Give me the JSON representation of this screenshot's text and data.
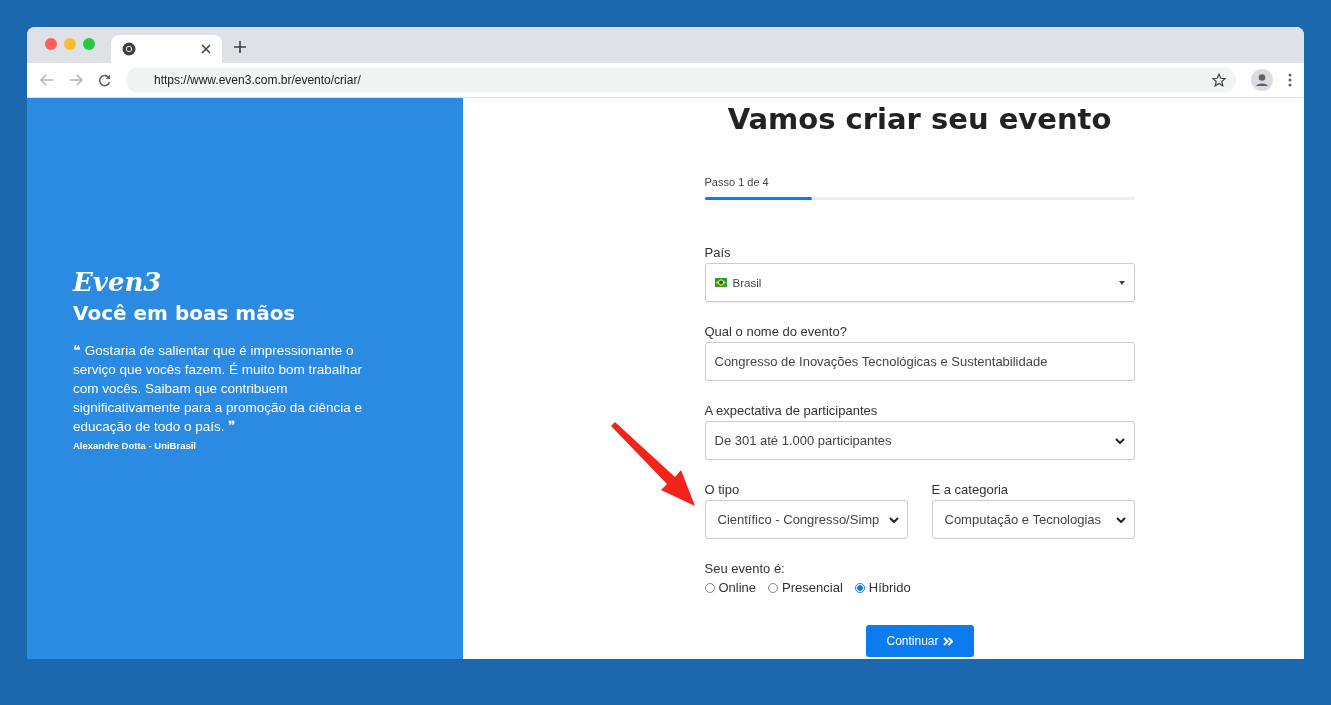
{
  "browser": {
    "url": "https://www.even3.com.br/evento/criar/"
  },
  "sidebar": {
    "logo": "Even3",
    "heading": "Você em boas mãos",
    "quote": "❝ Gostaria de salientar que é impressionante o serviço que vocês fazem. É muito bom trabalhar com vocês. Saibam que contribuem significativamente para a promoção da ciência e educação de todo o país. ❞",
    "author": "Alexandre Dotta - UniBrasil"
  },
  "form": {
    "title": "Vamos criar seu evento",
    "step": {
      "label": "Passo 1 de 4",
      "level": 0.25
    },
    "fields": [
      {
        "kind": "country",
        "label": "País",
        "value": "Brasil"
      },
      {
        "kind": "text",
        "label": "Qual o nome do evento?",
        "value": "Congresso de Inovações Tecnológicas e Sustentabilidade"
      },
      {
        "kind": "select",
        "label": "A expectativa de participantes",
        "value": "De 301 até 1.000 participantes"
      }
    ],
    "pair": [
      {
        "label": "O tipo",
        "value": "Científico - Congresso/Simp"
      },
      {
        "label": "E a categoria",
        "value": "Computação e Tecnologias"
      }
    ],
    "mode": {
      "label": "Seu evento é:",
      "options": [
        {
          "label": "Online",
          "selected": false
        },
        {
          "label": "Presencial",
          "selected": false
        },
        {
          "label": "Híbrido",
          "selected": true
        }
      ]
    },
    "submit": "Continuar"
  }
}
